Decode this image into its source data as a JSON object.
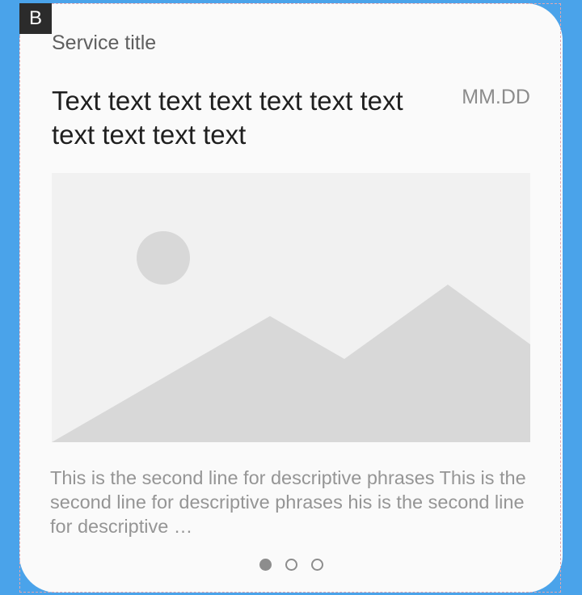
{
  "variant_tag": "B",
  "card": {
    "service_title": "Service title",
    "headline": "Text text text text text text text text text text text",
    "date": "MM.DD",
    "image": {
      "icon": "image-placeholder-icon"
    },
    "description": "This is the second line for descriptive phrases This is the second line for descriptive phrases his is the second line for descriptive …",
    "pagination": {
      "total": 3,
      "active_index": 0
    }
  },
  "colors": {
    "background": "#4aa3ea",
    "card": "#fafafa",
    "placeholder_bg": "#f1f1f1",
    "placeholder_shape": "#d8d8d8",
    "dot": "#8d8d8d"
  }
}
